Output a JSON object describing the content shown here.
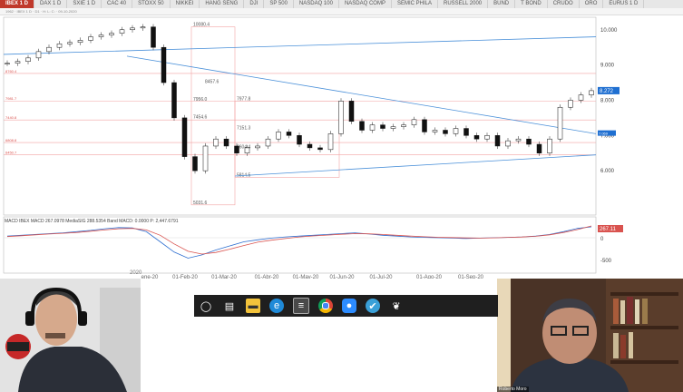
{
  "tabs": [
    {
      "label": "IBEX 1 D",
      "active": true
    },
    {
      "label": "DAX 1 D"
    },
    {
      "label": "SXIE 1 D"
    },
    {
      "label": "CAC 40"
    },
    {
      "label": "STOXX 50"
    },
    {
      "label": "NIKKEI"
    },
    {
      "label": "HANG SENG"
    },
    {
      "label": "DJI"
    },
    {
      "label": "SP 500"
    },
    {
      "label": "NASDAQ 100"
    },
    {
      "label": "NASDAQ COMP"
    },
    {
      "label": "SEMIC PHILA"
    },
    {
      "label": "RUSSELL 2000"
    },
    {
      "label": "BUND"
    },
    {
      "label": "T BOND"
    },
    {
      "label": "CRUDO"
    },
    {
      "label": "ORO"
    },
    {
      "label": "EURUS 1 D"
    }
  ],
  "chart_data": {
    "type": "line",
    "price_axis": {
      "ticks": [
        "10.000",
        "9.000",
        "8.000",
        "7.000",
        "6.000"
      ]
    },
    "last_price": "8.272",
    "secondary_price": "7.069",
    "price_levels": [
      "10080.4",
      "8457.6",
      "7956.0",
      "7977.8",
      "7454.6",
      "7151.3",
      "6604.4",
      "5814.5",
      "5031.6"
    ],
    "left_levels": [
      "8760.4",
      "7981.7",
      "7440.8",
      "6808.8",
      "6450.7"
    ],
    "x_ticks": [
      "ene-20",
      "01-Feb-20",
      "01-Mar-20",
      "01-Abr-20",
      "01-May-20",
      "01-Jun-20",
      "01-Jul-20",
      "01-Ago-20",
      "01-Sep-20"
    ],
    "year_label": "2020",
    "series": [
      {
        "name": "IBEX",
        "values": [
          9050,
          9100,
          9200,
          9380,
          9500,
          9600,
          9640,
          9700,
          9800,
          9850,
          9900,
          10000,
          10050,
          10080,
          9500,
          8500,
          7500,
          6400,
          6000,
          6700,
          6900,
          6700,
          6500,
          6650,
          6700,
          6900,
          7100,
          7000,
          6750,
          6650,
          6600,
          7050,
          7977,
          7400,
          7150,
          7300,
          7200,
          7250,
          7300,
          7450,
          7100,
          7150,
          7050,
          7200,
          7000,
          6900,
          7000,
          6700,
          6850,
          6900,
          6750,
          6500,
          6900,
          7800,
          8000,
          8150,
          8272
        ]
      }
    ],
    "macd": {
      "header": "MACD IBEX MACD",
      "values_text": "267.0978  MediaSIG 288.5354  Band  MACD: 0.0000  P: 2,447.6791",
      "label": "267.11",
      "zero_label": "0",
      "low_label": "-500",
      "line": [
        40,
        60,
        80,
        100,
        120,
        150,
        180,
        220,
        250,
        240,
        150,
        -100,
        -350,
        -500,
        -420,
        -300,
        -200,
        -100,
        -50,
        -10,
        20,
        40,
        60,
        80,
        100,
        120,
        90,
        60,
        40,
        20,
        10,
        0,
        -10,
        -20,
        -10,
        0,
        10,
        20,
        40,
        80,
        150,
        230,
        267
      ],
      "signal": [
        30,
        50,
        70,
        90,
        110,
        130,
        160,
        190,
        220,
        230,
        190,
        60,
        -150,
        -330,
        -400,
        -360,
        -280,
        -190,
        -110,
        -60,
        -20,
        20,
        45,
        65,
        85,
        100,
        95,
        80,
        60,
        40,
        25,
        12,
        5,
        -5,
        -8,
        -2,
        8,
        18,
        35,
        70,
        130,
        200,
        288
      ]
    },
    "grid": false
  },
  "taskbar": {
    "icons": [
      "search-icon",
      "task-view-icon",
      "file-explorer-icon",
      "edge-icon",
      "app-icon",
      "chrome-icon",
      "zoom-icon",
      "security-icon",
      "chat-icon"
    ]
  },
  "participant_right": {
    "name": "Roberto Moro"
  }
}
